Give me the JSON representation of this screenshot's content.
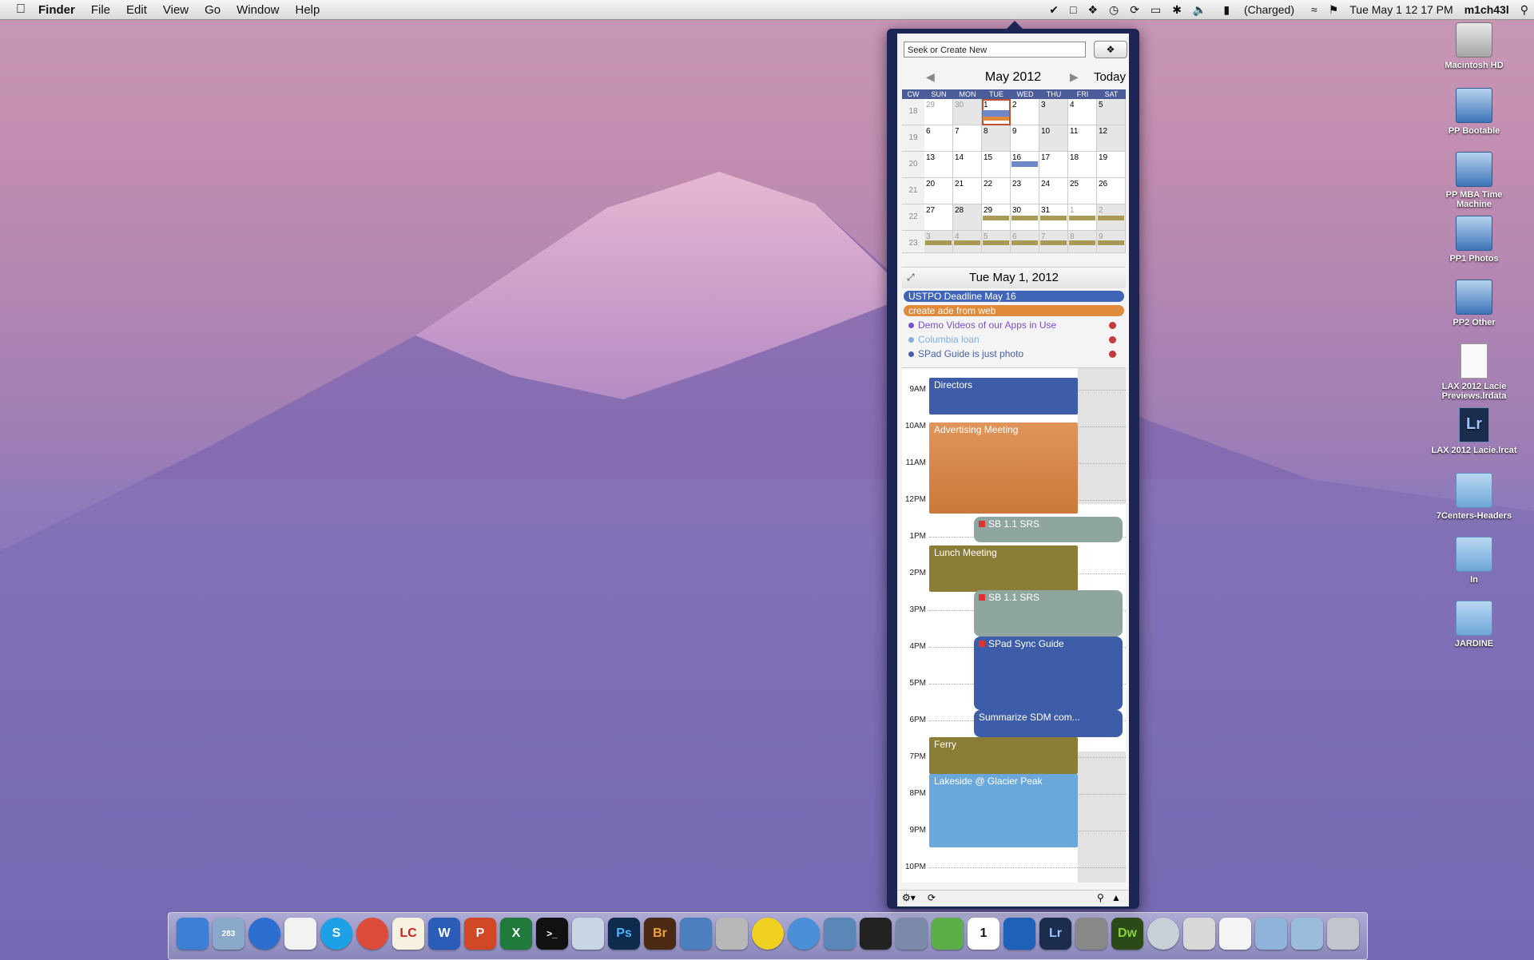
{
  "menubar": {
    "app": "Finder",
    "items": [
      "File",
      "Edit",
      "View",
      "Go",
      "Window",
      "Help"
    ],
    "battery": "(Charged)",
    "datetime": "Tue May 1  12 17 PM",
    "user": "m1ch43l"
  },
  "desktop_icons": [
    {
      "label": "Macintosh HD",
      "icon": "hard-drive-icon"
    },
    {
      "label": "PP Bootable",
      "icon": "external-drive-icon"
    },
    {
      "label": "PP MBA Time Machine",
      "icon": "external-drive-icon"
    },
    {
      "label": "PP1 Photos",
      "icon": "external-drive-icon"
    },
    {
      "label": "PP2 Other",
      "icon": "external-drive-icon"
    },
    {
      "label": "LAX 2012 Lacie Previews.lrdata",
      "icon": "data-file-icon"
    },
    {
      "label": "LAX 2012 Lacie.lrcat",
      "icon": "lightroom-catalog-icon"
    },
    {
      "label": "7Centers-Headers",
      "icon": "folder-icon"
    },
    {
      "label": "In",
      "icon": "folder-icon"
    },
    {
      "label": "JARDINE",
      "icon": "folder-icon"
    }
  ],
  "calendar": {
    "search_placeholder": "Seek or Create New",
    "month_title": "May 2012",
    "today_label": "Today",
    "weekday_headers": [
      "CW",
      "SUN",
      "MON",
      "TUE",
      "WED",
      "THU",
      "FRI",
      "SAT"
    ],
    "weeks": [
      {
        "cw": "18",
        "days": [
          "29",
          "30",
          "1",
          "2",
          "3",
          "4",
          "5"
        ]
      },
      {
        "cw": "19",
        "days": [
          "6",
          "7",
          "8",
          "9",
          "10",
          "11",
          "12"
        ]
      },
      {
        "cw": "20",
        "days": [
          "13",
          "14",
          "15",
          "16",
          "17",
          "18",
          "19"
        ]
      },
      {
        "cw": "21",
        "days": [
          "20",
          "21",
          "22",
          "23",
          "24",
          "25",
          "26"
        ]
      },
      {
        "cw": "22",
        "days": [
          "27",
          "28",
          "29",
          "30",
          "31",
          "1",
          "2"
        ]
      },
      {
        "cw": "23",
        "days": [
          "3",
          "4",
          "5",
          "6",
          "7",
          "8",
          "9"
        ]
      }
    ],
    "day_title": "Tue May 1, 2012",
    "all_day_events": [
      {
        "title": "USTPO Deadline May 16",
        "color": "#3f64b8"
      },
      {
        "title": "create ade from web",
        "color": "#e08a3c"
      }
    ],
    "tasks": [
      {
        "title": "Demo Videos of our Apps in Use",
        "color": "#7a4ed0"
      },
      {
        "title": "Columbia loan",
        "color": "#7fb0e0"
      },
      {
        "title": "SPad Guide is just photo",
        "color": "#4a5ea8"
      }
    ],
    "hours": [
      "9AM",
      "10AM",
      "11AM",
      "12PM",
      "1PM",
      "2PM",
      "3PM",
      "4PM",
      "5PM",
      "6PM",
      "7PM",
      "8PM",
      "9PM",
      "10PM"
    ],
    "events": [
      {
        "title": "Directors",
        "color": "#3d5da8"
      },
      {
        "title": "Advertising Meeting",
        "color": "#d98a4a"
      },
      {
        "title": "SB 1.1 SRS",
        "color": "#8fa6a0"
      },
      {
        "title": "Lunch Meeting",
        "color": "#8c7d36"
      },
      {
        "title": "SB 1.1 SRS",
        "color": "#8fa6a0"
      },
      {
        "title": "SPad Sync Guide",
        "color": "#3d5da8"
      },
      {
        "title": "Summarize SDM com...",
        "color": "#3d5da8"
      },
      {
        "title": "Ferry",
        "color": "#8c7d36"
      },
      {
        "title": "Lakeside @ Glacier Peak",
        "color": "#6aa8dc"
      }
    ]
  },
  "dock": [
    {
      "name": "finder",
      "label": ""
    },
    {
      "name": "mail",
      "label": "283"
    },
    {
      "name": "itunes",
      "label": ""
    },
    {
      "name": "textedit",
      "label": ""
    },
    {
      "name": "skype",
      "label": "S"
    },
    {
      "name": "chrome",
      "label": ""
    },
    {
      "name": "lc",
      "label": "LC"
    },
    {
      "name": "word",
      "label": "W"
    },
    {
      "name": "powerpoint",
      "label": "P"
    },
    {
      "name": "excel",
      "label": "X"
    },
    {
      "name": "terminal",
      "label": ">_"
    },
    {
      "name": "preview",
      "label": ""
    },
    {
      "name": "photoshop",
      "label": "Ps"
    },
    {
      "name": "bridge",
      "label": "Br"
    },
    {
      "name": "xcode",
      "label": ""
    },
    {
      "name": "keychain",
      "label": ""
    },
    {
      "name": "sync",
      "label": ""
    },
    {
      "name": "safari",
      "label": ""
    },
    {
      "name": "network",
      "label": ""
    },
    {
      "name": "activity-monitor",
      "label": ""
    },
    {
      "name": "system",
      "label": ""
    },
    {
      "name": "sparkle",
      "label": ""
    },
    {
      "name": "ical",
      "label": "1"
    },
    {
      "name": "ipad",
      "label": ""
    },
    {
      "name": "lightroom",
      "label": "Lr"
    },
    {
      "name": "camera",
      "label": ""
    },
    {
      "name": "dreamweaver",
      "label": "Dw"
    },
    {
      "name": "disk-utility",
      "label": ""
    },
    {
      "name": "installer",
      "label": ""
    },
    {
      "name": "document",
      "label": ""
    },
    {
      "name": "applications-folder",
      "label": ""
    },
    {
      "name": "downloads-folder",
      "label": ""
    },
    {
      "name": "trash",
      "label": ""
    }
  ]
}
